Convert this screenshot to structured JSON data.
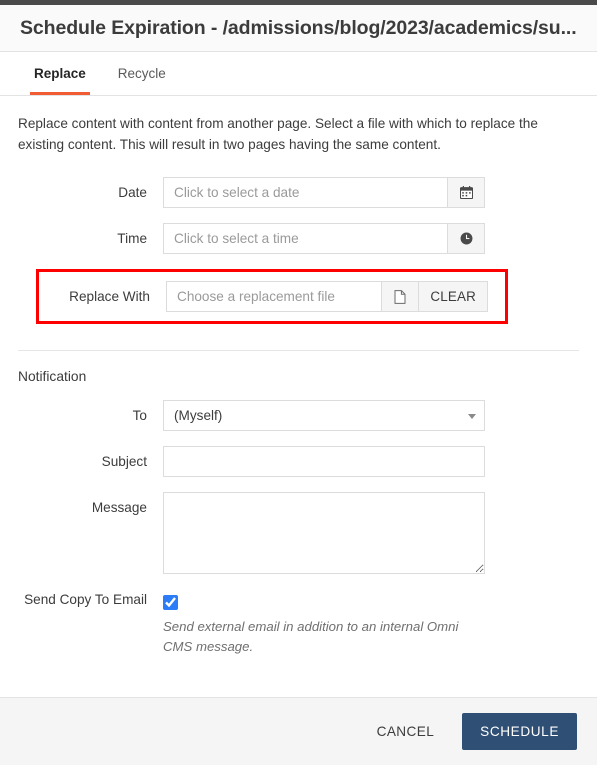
{
  "header": {
    "title": "Schedule Expiration - /admissions/blog/2023/academics/su..."
  },
  "tabs": [
    {
      "label": "Replace",
      "active": true
    },
    {
      "label": "Recycle",
      "active": false
    }
  ],
  "main": {
    "intro": "Replace content with content from another page. Select a file with which to replace the existing content. This will result in two pages having the same content.",
    "date": {
      "label": "Date",
      "value": "",
      "placeholder": "Click to select a date",
      "icon": "calendar-icon"
    },
    "time": {
      "label": "Time",
      "value": "",
      "placeholder": "Click to select a time",
      "icon": "clock-icon"
    },
    "replace_with": {
      "label": "Replace With",
      "value": "",
      "placeholder": "Choose a replacement file",
      "icon": "file-icon",
      "clear_label": "CLEAR",
      "highlighted": true,
      "highlight_color": "#ff0000"
    }
  },
  "notification": {
    "section_title": "Notification",
    "to": {
      "label": "To",
      "value": "(Myself)",
      "options": [
        "(Myself)"
      ]
    },
    "subject": {
      "label": "Subject",
      "value": "",
      "placeholder": ""
    },
    "message": {
      "label": "Message",
      "value": "",
      "placeholder": ""
    },
    "send_copy": {
      "label": "Send Copy To Email",
      "checked": true,
      "hint": "Send external email in addition to an internal Omni CMS message."
    }
  },
  "footer": {
    "cancel_label": "CANCEL",
    "schedule_label": "SCHEDULE",
    "primary_color": "#2f4f74"
  }
}
